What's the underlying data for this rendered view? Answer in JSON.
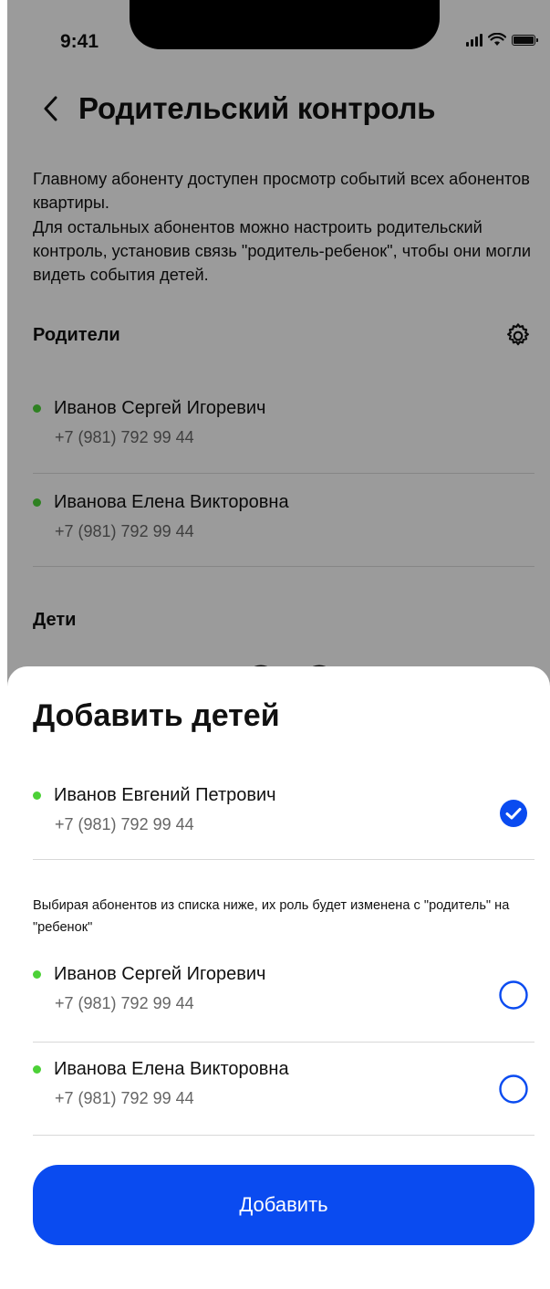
{
  "status_bar": {
    "time": "9:41"
  },
  "header": {
    "title": "Родительский контроль"
  },
  "intro": {
    "line1": "Главному абоненту доступен просмотр событий всех абонентов квартиры.",
    "line2": "Для остальных абонентов можно настроить родительский контроль, установив связь \"родитель-ребенок\", чтобы они могли видеть события детей."
  },
  "parents": {
    "title": "Родители",
    "items": [
      {
        "name": "Иванов Сергей Игоревич",
        "phone": "+7 (981) 792 99 44"
      },
      {
        "name": "Иванова Елена Викторовна",
        "phone": "+7 (981) 792 99 44"
      }
    ]
  },
  "children": {
    "title": "Дети"
  },
  "sheet": {
    "title": "Добавить детей",
    "selected": [
      {
        "name": "Иванов Евгений Петрович",
        "phone": "+7 (981) 792 99 44",
        "checked": true
      }
    ],
    "hint": "Выбирая абонентов из списка ниже, их роль будет изменена с \"родитель\" на \"ребенок\"",
    "options": [
      {
        "name": "Иванов Сергей Игоревич",
        "phone": "+7 (981) 792 99 44",
        "checked": false
      },
      {
        "name": "Иванова Елена Викторовна",
        "phone": "+7 (981) 792 99 44",
        "checked": false
      }
    ],
    "button_label": "Добавить"
  },
  "colors": {
    "accent": "#0A4BF0",
    "status_dot": "#4CD137"
  }
}
